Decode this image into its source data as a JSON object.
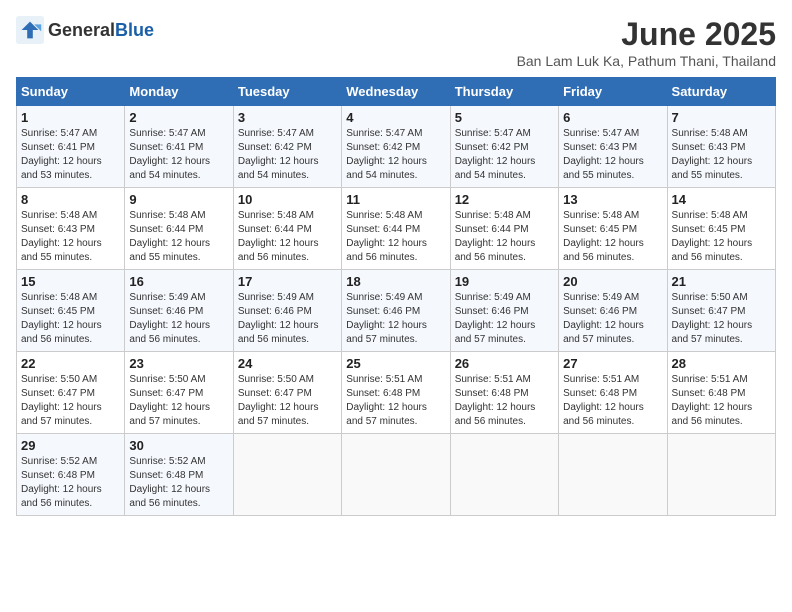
{
  "header": {
    "logo_general": "General",
    "logo_blue": "Blue",
    "title": "June 2025",
    "subtitle": "Ban Lam Luk Ka, Pathum Thani, Thailand"
  },
  "weekdays": [
    "Sunday",
    "Monday",
    "Tuesday",
    "Wednesday",
    "Thursday",
    "Friday",
    "Saturday"
  ],
  "weeks": [
    [
      {
        "day": "1",
        "sunrise": "Sunrise: 5:47 AM",
        "sunset": "Sunset: 6:41 PM",
        "daylight": "Daylight: 12 hours and 53 minutes."
      },
      {
        "day": "2",
        "sunrise": "Sunrise: 5:47 AM",
        "sunset": "Sunset: 6:41 PM",
        "daylight": "Daylight: 12 hours and 54 minutes."
      },
      {
        "day": "3",
        "sunrise": "Sunrise: 5:47 AM",
        "sunset": "Sunset: 6:42 PM",
        "daylight": "Daylight: 12 hours and 54 minutes."
      },
      {
        "day": "4",
        "sunrise": "Sunrise: 5:47 AM",
        "sunset": "Sunset: 6:42 PM",
        "daylight": "Daylight: 12 hours and 54 minutes."
      },
      {
        "day": "5",
        "sunrise": "Sunrise: 5:47 AM",
        "sunset": "Sunset: 6:42 PM",
        "daylight": "Daylight: 12 hours and 54 minutes."
      },
      {
        "day": "6",
        "sunrise": "Sunrise: 5:47 AM",
        "sunset": "Sunset: 6:43 PM",
        "daylight": "Daylight: 12 hours and 55 minutes."
      },
      {
        "day": "7",
        "sunrise": "Sunrise: 5:48 AM",
        "sunset": "Sunset: 6:43 PM",
        "daylight": "Daylight: 12 hours and 55 minutes."
      }
    ],
    [
      {
        "day": "8",
        "sunrise": "Sunrise: 5:48 AM",
        "sunset": "Sunset: 6:43 PM",
        "daylight": "Daylight: 12 hours and 55 minutes."
      },
      {
        "day": "9",
        "sunrise": "Sunrise: 5:48 AM",
        "sunset": "Sunset: 6:44 PM",
        "daylight": "Daylight: 12 hours and 55 minutes."
      },
      {
        "day": "10",
        "sunrise": "Sunrise: 5:48 AM",
        "sunset": "Sunset: 6:44 PM",
        "daylight": "Daylight: 12 hours and 56 minutes."
      },
      {
        "day": "11",
        "sunrise": "Sunrise: 5:48 AM",
        "sunset": "Sunset: 6:44 PM",
        "daylight": "Daylight: 12 hours and 56 minutes."
      },
      {
        "day": "12",
        "sunrise": "Sunrise: 5:48 AM",
        "sunset": "Sunset: 6:44 PM",
        "daylight": "Daylight: 12 hours and 56 minutes."
      },
      {
        "day": "13",
        "sunrise": "Sunrise: 5:48 AM",
        "sunset": "Sunset: 6:45 PM",
        "daylight": "Daylight: 12 hours and 56 minutes."
      },
      {
        "day": "14",
        "sunrise": "Sunrise: 5:48 AM",
        "sunset": "Sunset: 6:45 PM",
        "daylight": "Daylight: 12 hours and 56 minutes."
      }
    ],
    [
      {
        "day": "15",
        "sunrise": "Sunrise: 5:48 AM",
        "sunset": "Sunset: 6:45 PM",
        "daylight": "Daylight: 12 hours and 56 minutes."
      },
      {
        "day": "16",
        "sunrise": "Sunrise: 5:49 AM",
        "sunset": "Sunset: 6:46 PM",
        "daylight": "Daylight: 12 hours and 56 minutes."
      },
      {
        "day": "17",
        "sunrise": "Sunrise: 5:49 AM",
        "sunset": "Sunset: 6:46 PM",
        "daylight": "Daylight: 12 hours and 56 minutes."
      },
      {
        "day": "18",
        "sunrise": "Sunrise: 5:49 AM",
        "sunset": "Sunset: 6:46 PM",
        "daylight": "Daylight: 12 hours and 57 minutes."
      },
      {
        "day": "19",
        "sunrise": "Sunrise: 5:49 AM",
        "sunset": "Sunset: 6:46 PM",
        "daylight": "Daylight: 12 hours and 57 minutes."
      },
      {
        "day": "20",
        "sunrise": "Sunrise: 5:49 AM",
        "sunset": "Sunset: 6:46 PM",
        "daylight": "Daylight: 12 hours and 57 minutes."
      },
      {
        "day": "21",
        "sunrise": "Sunrise: 5:50 AM",
        "sunset": "Sunset: 6:47 PM",
        "daylight": "Daylight: 12 hours and 57 minutes."
      }
    ],
    [
      {
        "day": "22",
        "sunrise": "Sunrise: 5:50 AM",
        "sunset": "Sunset: 6:47 PM",
        "daylight": "Daylight: 12 hours and 57 minutes."
      },
      {
        "day": "23",
        "sunrise": "Sunrise: 5:50 AM",
        "sunset": "Sunset: 6:47 PM",
        "daylight": "Daylight: 12 hours and 57 minutes."
      },
      {
        "day": "24",
        "sunrise": "Sunrise: 5:50 AM",
        "sunset": "Sunset: 6:47 PM",
        "daylight": "Daylight: 12 hours and 57 minutes."
      },
      {
        "day": "25",
        "sunrise": "Sunrise: 5:51 AM",
        "sunset": "Sunset: 6:48 PM",
        "daylight": "Daylight: 12 hours and 57 minutes."
      },
      {
        "day": "26",
        "sunrise": "Sunrise: 5:51 AM",
        "sunset": "Sunset: 6:48 PM",
        "daylight": "Daylight: 12 hours and 56 minutes."
      },
      {
        "day": "27",
        "sunrise": "Sunrise: 5:51 AM",
        "sunset": "Sunset: 6:48 PM",
        "daylight": "Daylight: 12 hours and 56 minutes."
      },
      {
        "day": "28",
        "sunrise": "Sunrise: 5:51 AM",
        "sunset": "Sunset: 6:48 PM",
        "daylight": "Daylight: 12 hours and 56 minutes."
      }
    ],
    [
      {
        "day": "29",
        "sunrise": "Sunrise: 5:52 AM",
        "sunset": "Sunset: 6:48 PM",
        "daylight": "Daylight: 12 hours and 56 minutes."
      },
      {
        "day": "30",
        "sunrise": "Sunrise: 5:52 AM",
        "sunset": "Sunset: 6:48 PM",
        "daylight": "Daylight: 12 hours and 56 minutes."
      },
      null,
      null,
      null,
      null,
      null
    ]
  ]
}
